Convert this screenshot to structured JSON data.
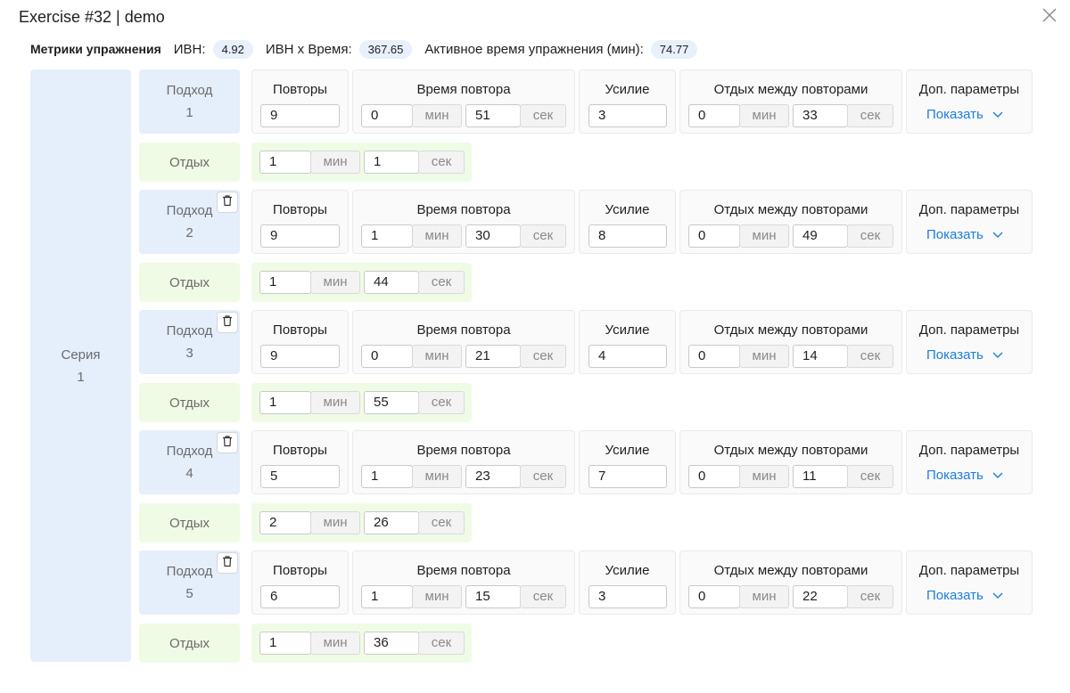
{
  "dialog": {
    "title": "Exercise #32 | demo"
  },
  "metrics": {
    "heading": "Метрики упражнения",
    "ivn_label": "ИВН:",
    "ivn_value": "4.92",
    "ivn_time_label": "ИВН x Время:",
    "ivn_time_value": "367.65",
    "active_time_label": "Активное время упражнения (мин):",
    "active_time_value": "74.77"
  },
  "series": {
    "label": "Серия",
    "number": "1"
  },
  "labels": {
    "set": "Подход",
    "rest": "Отдых",
    "reps": "Повторы",
    "rep_time": "Время повтора",
    "effort": "Усилие",
    "rest_between": "Отдых между повторами",
    "extra_params": "Доп. параметры",
    "show": "Показать",
    "min": "мин",
    "sec": "сек"
  },
  "sets": [
    {
      "number": "1",
      "reps": "9",
      "rep_time_min": "0",
      "rep_time_sec": "51",
      "effort": "3",
      "rest_between_min": "0",
      "rest_between_sec": "33",
      "rest_min": "1",
      "rest_sec": "1"
    },
    {
      "number": "2",
      "reps": "9",
      "rep_time_min": "1",
      "rep_time_sec": "30",
      "effort": "8",
      "rest_between_min": "0",
      "rest_between_sec": "49",
      "rest_min": "1",
      "rest_sec": "44"
    },
    {
      "number": "3",
      "reps": "9",
      "rep_time_min": "0",
      "rep_time_sec": "21",
      "effort": "4",
      "rest_between_min": "0",
      "rest_between_sec": "14",
      "rest_min": "1",
      "rest_sec": "55"
    },
    {
      "number": "4",
      "reps": "5",
      "rep_time_min": "1",
      "rep_time_sec": "23",
      "effort": "7",
      "rest_between_min": "0",
      "rest_between_sec": "11",
      "rest_min": "2",
      "rest_sec": "26"
    },
    {
      "number": "5",
      "reps": "6",
      "rep_time_min": "1",
      "rep_time_sec": "15",
      "effort": "3",
      "rest_between_min": "0",
      "rest_between_sec": "22",
      "rest_min": "1",
      "rest_sec": "36"
    }
  ]
}
